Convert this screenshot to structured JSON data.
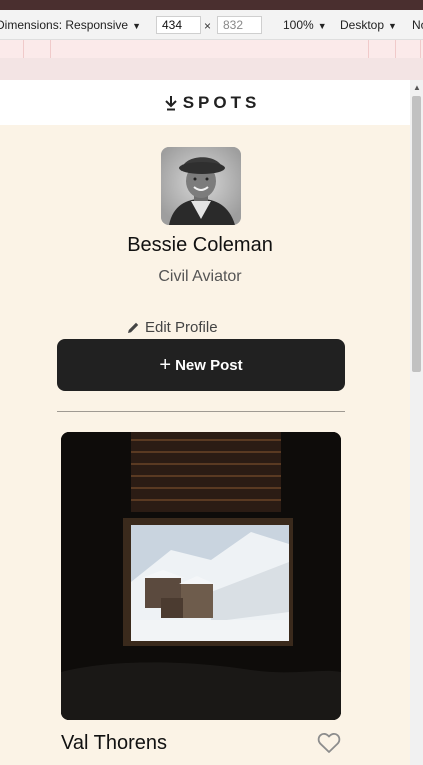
{
  "devtools": {
    "dimensions_label": "Dimensions: Responsive",
    "width_value": "434",
    "height_value": "832",
    "times_symbol": "×",
    "zoom_label": "100%",
    "device_label": "Desktop",
    "overflow_label": "No"
  },
  "site": {
    "logo_text": "SPOTS"
  },
  "profile": {
    "name": "Bessie Coleman",
    "role": "Civil Aviator",
    "edit_label": "Edit Profile",
    "new_post_label": "New Post",
    "new_post_symbol": "+"
  },
  "cards": [
    {
      "title": "Val Thorens",
      "liked": false
    }
  ],
  "colors": {
    "page_background": "#fbf3e6",
    "button_background": "#212121",
    "text": "#212121"
  }
}
